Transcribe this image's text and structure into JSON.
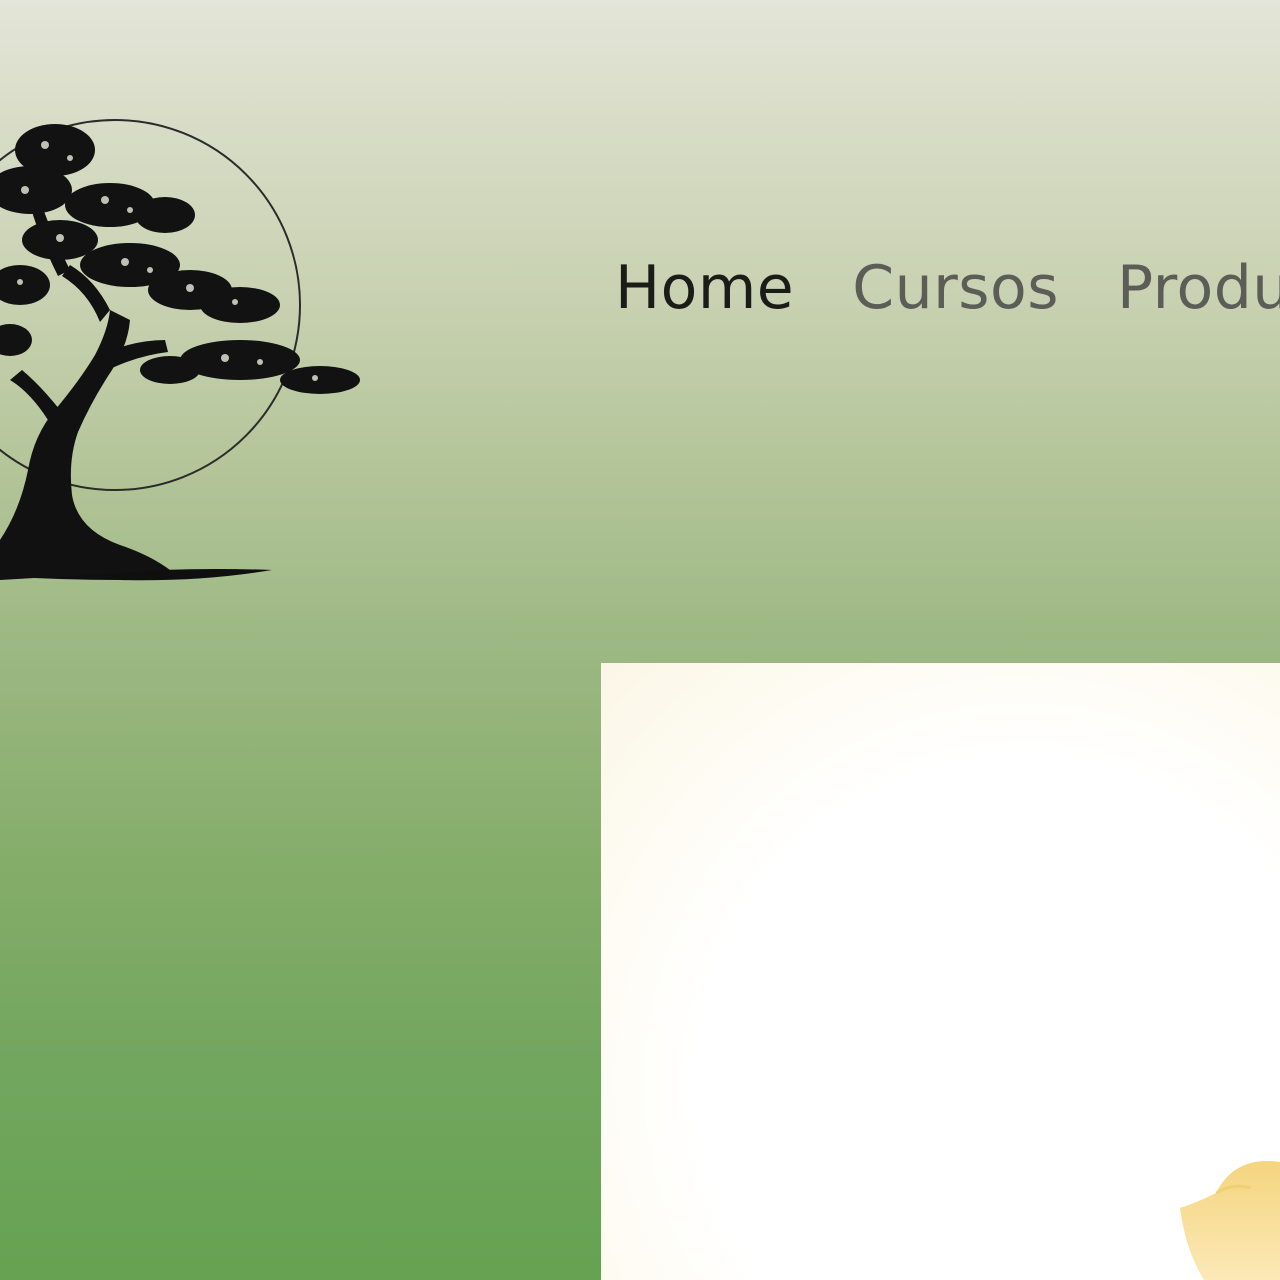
{
  "colors": {
    "background_top": "#e3e5d8",
    "background_bottom": "#66a252",
    "nav_active": "#1a1c17",
    "nav_inactive": "#5c5d57",
    "card_bg": "#ffffff",
    "flower": "#f6d98a"
  },
  "logo": {
    "icon": "bonsai-tree-icon"
  },
  "nav": {
    "items": [
      {
        "label": "Home",
        "active": true
      },
      {
        "label": "Cursos",
        "active": false
      },
      {
        "label": "Produ",
        "active": false
      }
    ]
  },
  "hero": {
    "decoration_icon": "lotus-flower-icon"
  }
}
